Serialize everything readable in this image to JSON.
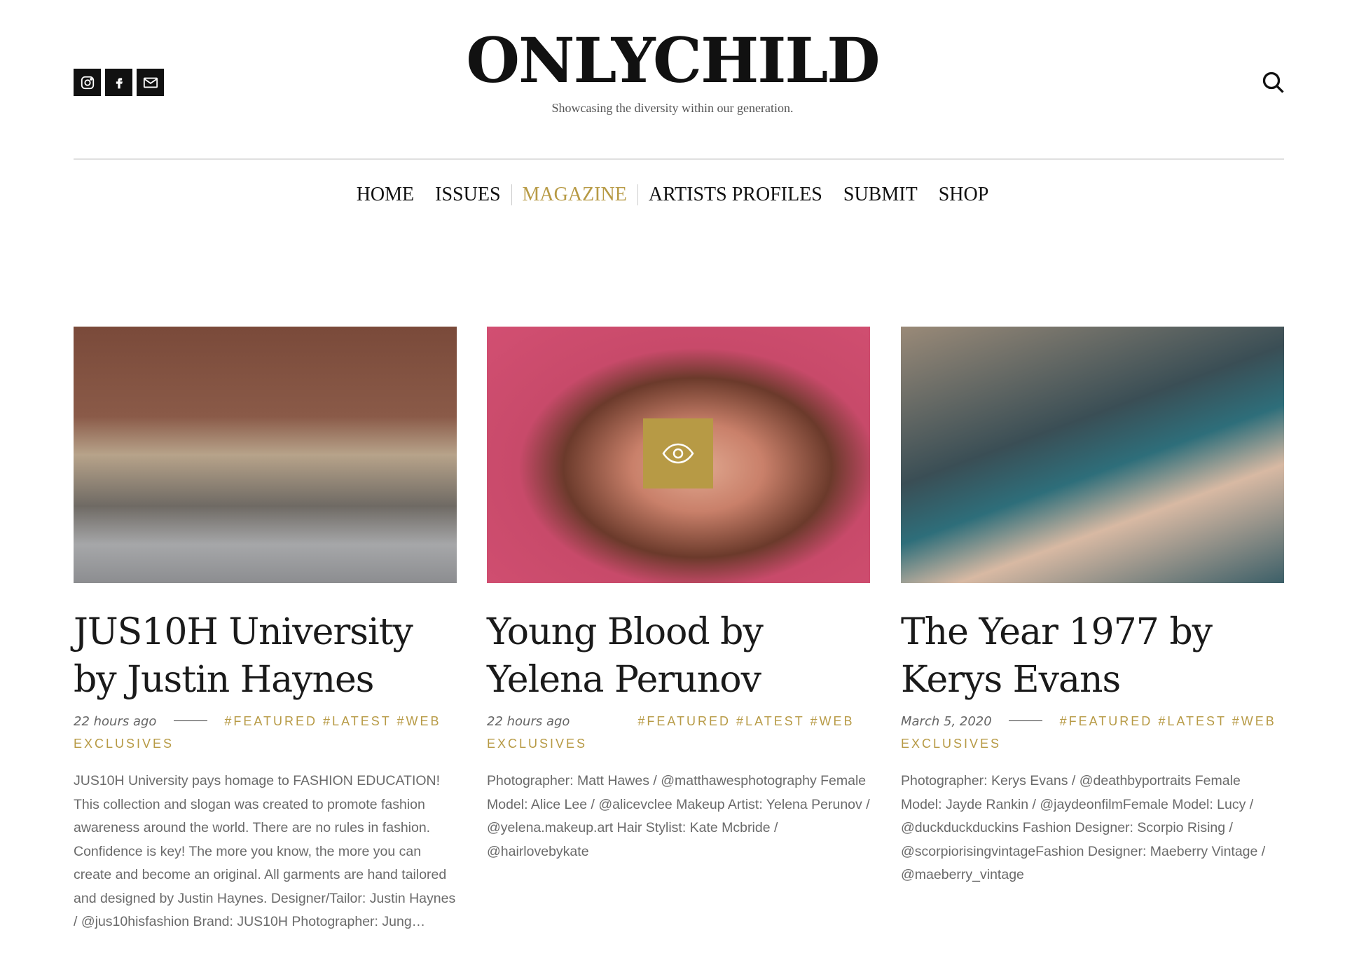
{
  "header": {
    "logo": "ONLYCHILD",
    "tagline": "Showcasing the diversity within our generation.",
    "socials": [
      {
        "icon": "instagram-icon"
      },
      {
        "icon": "facebook-icon"
      },
      {
        "icon": "email-icon"
      }
    ],
    "search_icon": "search-icon"
  },
  "nav": {
    "items": [
      {
        "label": "HOME"
      },
      {
        "label": "ISSUES"
      },
      {
        "label": "MAGAZINE",
        "active": true
      },
      {
        "label": "ARTISTS PROFILES"
      },
      {
        "label": "SUBMIT"
      },
      {
        "label": "SHOP"
      }
    ]
  },
  "colors": {
    "accent": "#b79a45",
    "text": "#1a1a1a",
    "muted": "#6a6a6a"
  },
  "cards": [
    {
      "title": "JUS10H University by Justin Haynes",
      "date": "22 hours ago",
      "tags": [
        "#FEATURED",
        "#LATEST",
        "#WEB EXCLUSIVES"
      ],
      "excerpt": "JUS10H University pays homage to FASHION EDUCATION! This collection and slogan was created to promote fashion awareness around the world.  There are no rules in fashion. Confidence is key! The more you know, the more you can create and become an original.  All garments are hand tailored and designed by Justin Haynes. Designer/Tailor: Justin Haynes / @jus10hisfashion Brand: JUS10H Photographer: Jung…"
    },
    {
      "title": "Young Blood by Yelena Perunov",
      "date": "22 hours ago",
      "tags": [
        "#FEATURED",
        "#LATEST",
        "#WEB EXCLUSIVES"
      ],
      "excerpt": "Photographer: Matt Hawes / @matthawesphotography Female Model: Alice Lee / @alicevclee Makeup Artist: Yelena Perunov / @yelena.makeup.art Hair Stylist: Kate Mcbride / @hairlovebykate",
      "overlay_icon": "eye-icon"
    },
    {
      "title": "The Year 1977 by Kerys Evans",
      "date": "March 5, 2020",
      "tags": [
        "#FEATURED",
        "#LATEST",
        "#WEB EXCLUSIVES"
      ],
      "excerpt": "Photographer: Kerys Evans / @deathbyportraits Female Model: Jayde Rankin / @jaydeonfilmFemale Model: Lucy / @duckduckduckins Fashion Designer: Scorpio Rising / @scorpiorisingvintageFashion Designer: Maeberry Vintage / @maeberry_vintage"
    }
  ]
}
